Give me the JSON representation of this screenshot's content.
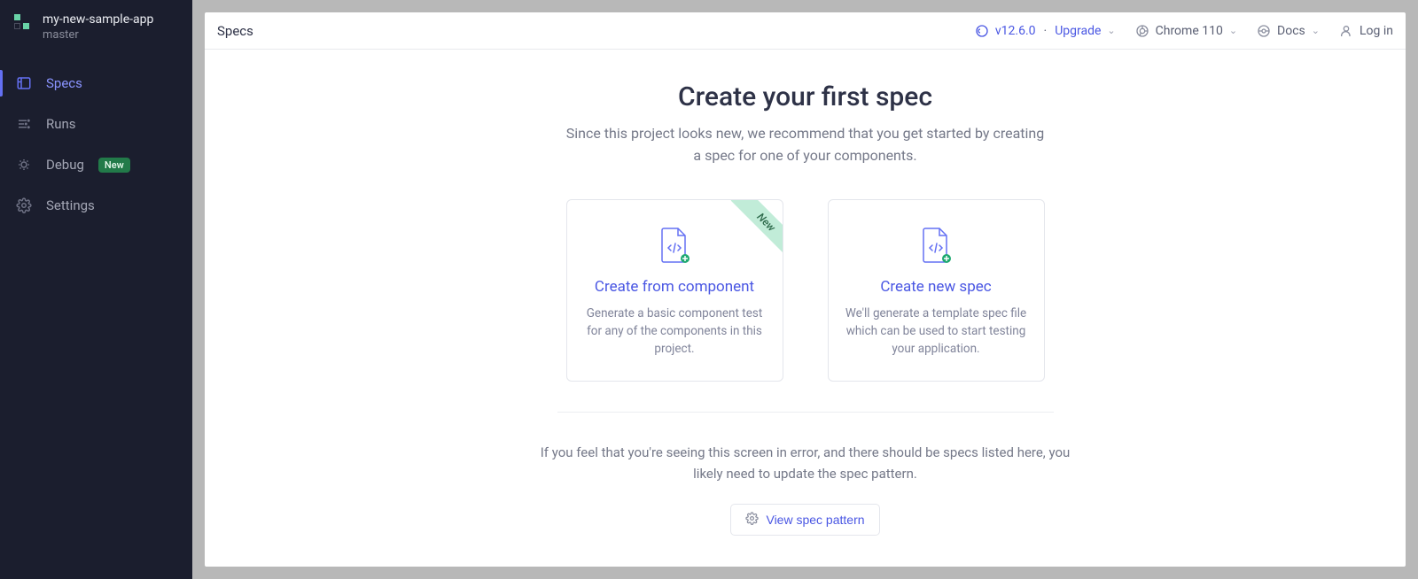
{
  "project": {
    "name": "my-new-sample-app",
    "branch": "master"
  },
  "sidebar": {
    "items": [
      {
        "label": "Specs",
        "active": true
      },
      {
        "label": "Runs",
        "active": false
      },
      {
        "label": "Debug",
        "active": false,
        "badge": "New"
      },
      {
        "label": "Settings",
        "active": false
      }
    ]
  },
  "topbar": {
    "title": "Specs",
    "version": "v12.6.0",
    "upgrade": "Upgrade",
    "browser": "Chrome 110",
    "docs": "Docs",
    "login": "Log in"
  },
  "hero": {
    "title": "Create your first spec",
    "subtitle": "Since this project looks new, we recommend that you get started by creating a spec for one of your components."
  },
  "cards": [
    {
      "ribbon": "New",
      "title": "Create from component",
      "desc": "Generate a basic component test for any of the components in this project."
    },
    {
      "title": "Create new spec",
      "desc": "We'll generate a template spec file which can be used to start testing your application."
    }
  ],
  "footer": {
    "text": "If you feel that you're seeing this screen in error, and there should be specs listed here, you likely need to update the spec pattern.",
    "button": "View spec pattern"
  }
}
